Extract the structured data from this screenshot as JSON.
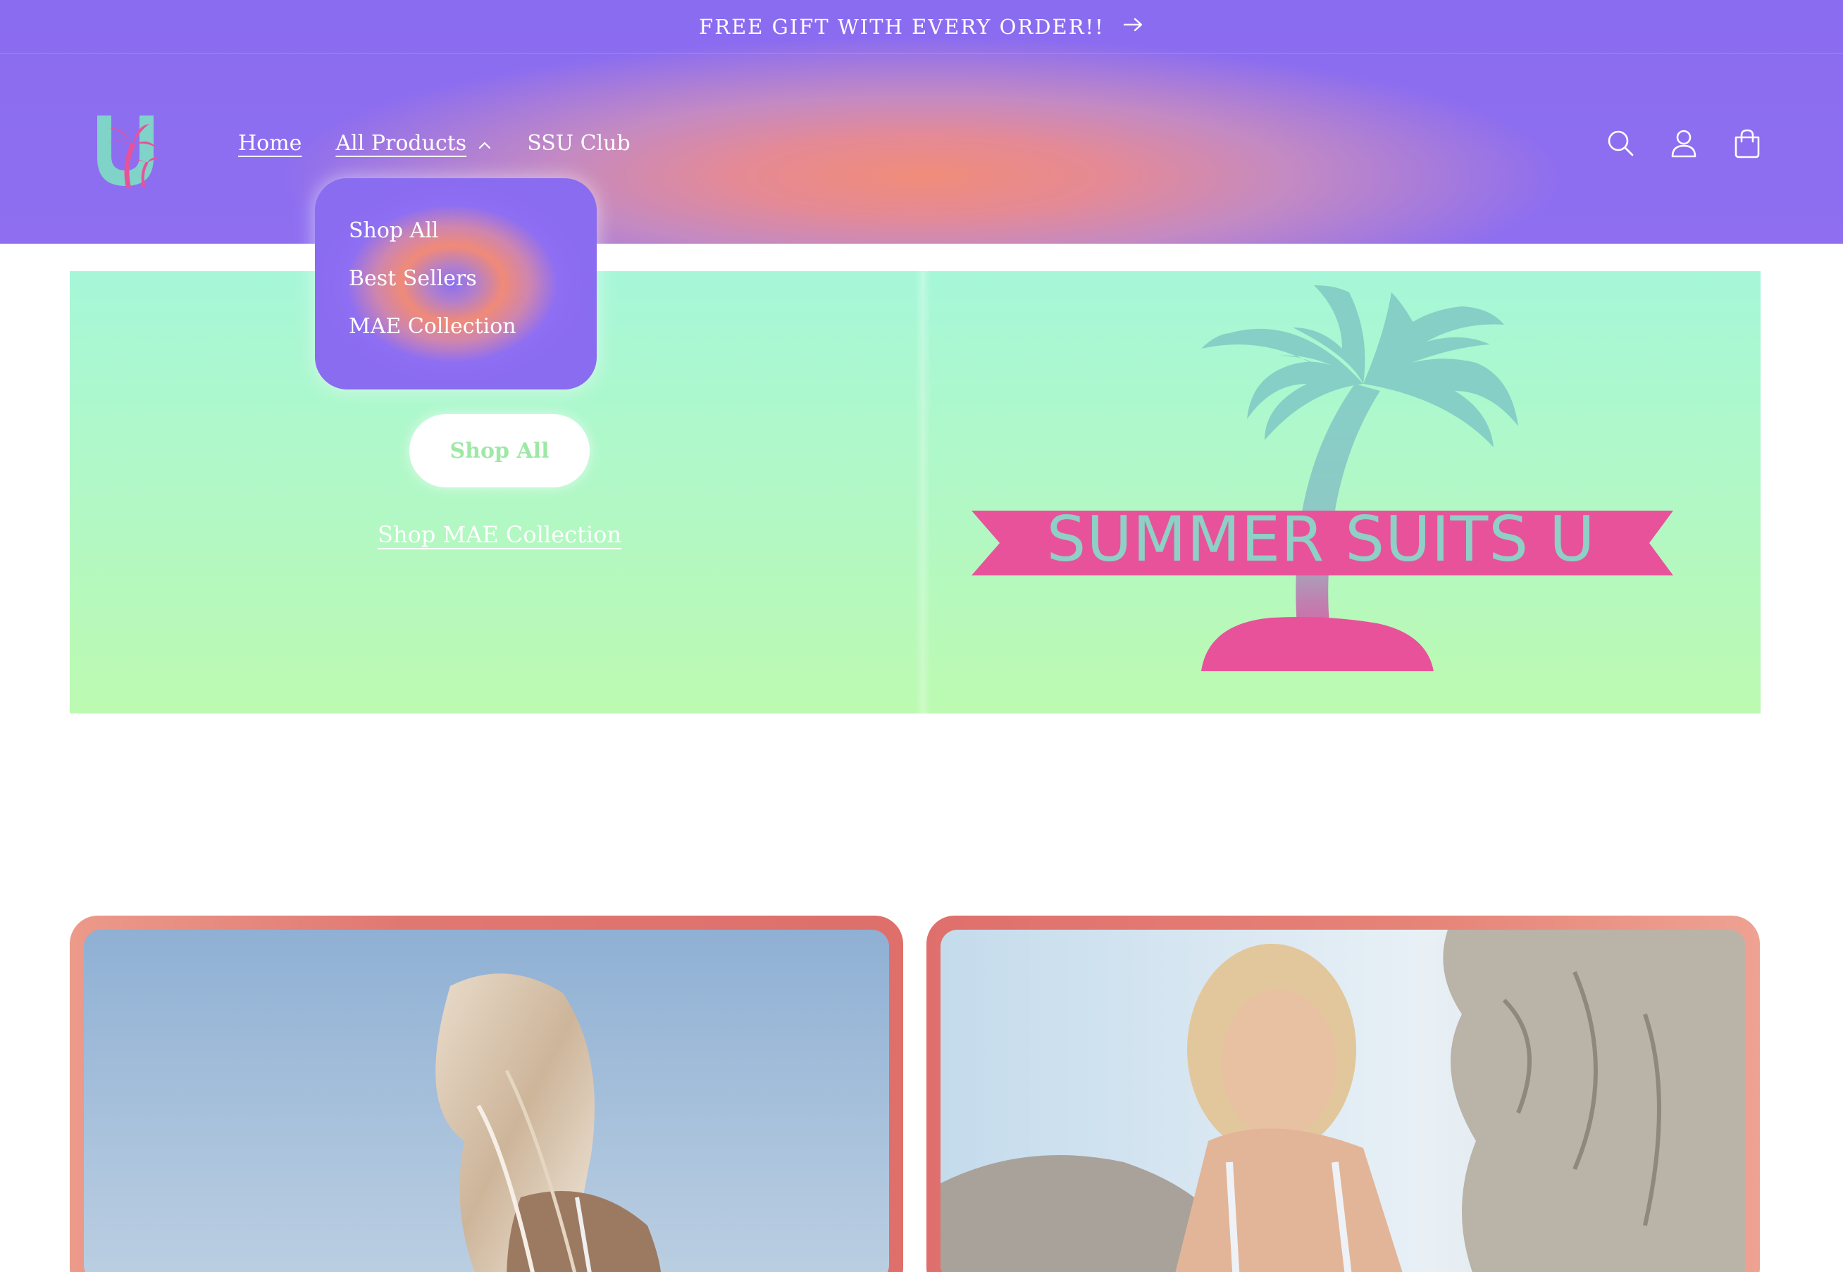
{
  "announcement": {
    "text": "FREE GIFT WITH EVERY ORDER!!",
    "arrow_icon": "arrow-right-icon"
  },
  "header": {
    "logo_icon": "palm-tree-u-logo-icon",
    "nav": {
      "home_label": "Home",
      "all_products_label": "All Products",
      "ssu_club_label": "SSU Club"
    },
    "icons": [
      "search-icon",
      "account-icon",
      "cart-icon"
    ]
  },
  "dropdown": {
    "items": [
      {
        "label": "Shop All"
      },
      {
        "label": "Best Sellers"
      },
      {
        "label": "MAE Collection"
      }
    ]
  },
  "hero": {
    "shop_all_label": "Shop All",
    "shop_mae_label": "Shop MAE Collection",
    "banner_text": "SUMMER SUITS U"
  },
  "colors": {
    "purple": "#8a6cf0",
    "coral": "#f08c7a",
    "mint": "#a6f7d8",
    "pink": "#e8529a",
    "teal": "#8ecfc6",
    "card_frame": "#e07872"
  }
}
